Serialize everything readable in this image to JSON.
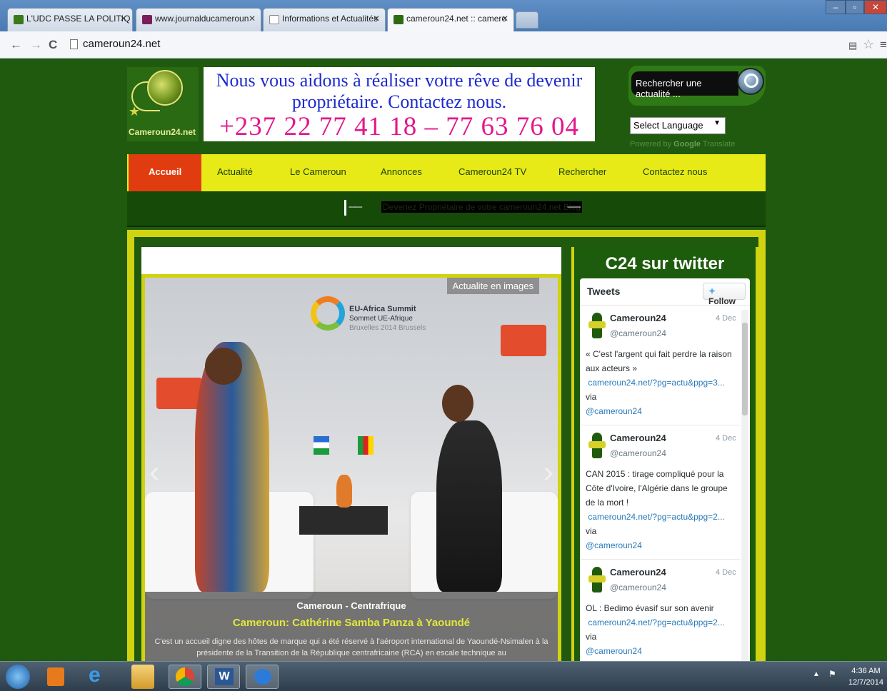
{
  "browser": {
    "tabs": [
      {
        "label": "L'UDC PASSE LA POLITIQ",
        "favicon_color": "#3a7a1a"
      },
      {
        "label": "www.journalducameroun",
        "favicon_color": "#7a1d5a"
      },
      {
        "label": "Informations et Actualités",
        "favicon_color": "#ffffff"
      },
      {
        "label": "cameroun24.net :: camero",
        "favicon_color": "#2f6a10"
      }
    ],
    "url": "cameroun24.net"
  },
  "site": {
    "logo_name": "Cameroun24.net",
    "banner_line1": "Nous vous aidons à réaliser votre rêve de devenir propriétaire. Contactez nous.",
    "banner_line2": "+237 22 77 41 18  –  77 63 76 04",
    "search_placeholder": "Rechercher une actualité ...",
    "language_select": "Select Language",
    "powered_by": "Powered by",
    "powered_google": "Google",
    "powered_translate": "Translate",
    "nav": [
      "Accueil",
      "Actualité",
      "Le Cameroun",
      "Annonces",
      "Cameroun24 TV",
      "Rechercher",
      "Contactez nous"
    ],
    "ticker_dashes": "-------",
    "ticker_text": "Devenez Propriétaire de votre cameroun24.net Blog"
  },
  "slider": {
    "badge": "Actualite en images",
    "summit_line1": "EU-Africa Summit",
    "summit_line2": "Sommet UE-Afrique",
    "summit_line3": "Bruxelles 2014 Brussels",
    "category": "Cameroun - Centrafrique",
    "title": "Cameroun: Cathérine Samba Panza à Yaoundé",
    "description": "C'est un accueil digne des hôtes de marque qui a été réservé à l'aéroport international de Yaoundé-Nsimalen à la présidente de la Transition de la République centrafricaine (RCA) en escale technique au"
  },
  "twitter": {
    "section_title": "C24 sur twitter",
    "widget_title": "Tweets",
    "follow_label": "Follow",
    "tweets": [
      {
        "name": "Cameroun24",
        "handle": "@cameroun24",
        "date": "4 Dec",
        "text": "« C'est l'argent qui fait perdre la raison aux acteurs »",
        "link": "cameroun24.net/?pg=actu&ppg=3...",
        "via": "via",
        "via_handle": "@cameroun24"
      },
      {
        "name": "Cameroun24",
        "handle": "@cameroun24",
        "date": "4 Dec",
        "text": "CAN 2015 : tirage compliqué pour la Côte d'Ivoire, l'Algérie dans le groupe de la mort !",
        "link": "cameroun24.net/?pg=actu&ppg=2...",
        "via": "via",
        "via_handle": "@cameroun24"
      },
      {
        "name": "Cameroun24",
        "handle": "@cameroun24",
        "date": "4 Dec",
        "text": "OL : Bedimo évasif sur son avenir",
        "link": "cameroun24.net/?pg=actu&ppg=2...",
        "via": "via",
        "via_handle": "@cameroun24"
      }
    ]
  },
  "taskbar": {
    "time": "4:36 AM",
    "date": "12/7/2014"
  }
}
